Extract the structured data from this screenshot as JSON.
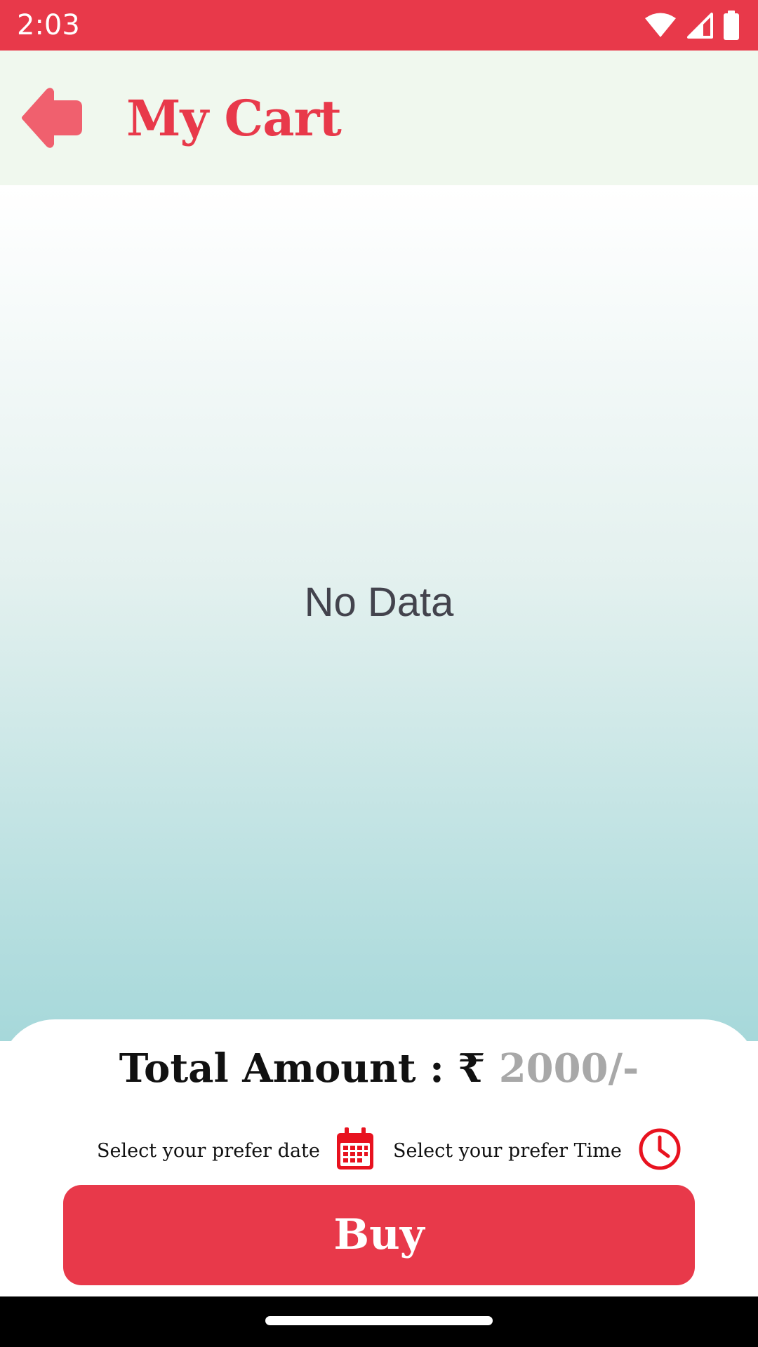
{
  "status_bar": {
    "time": "2:03",
    "icons": [
      "wifi-icon",
      "signal-icon",
      "battery-icon"
    ]
  },
  "header": {
    "back_icon": "back-arrow-icon",
    "title": "My Cart"
  },
  "content": {
    "empty_message": "No Data"
  },
  "summary": {
    "total_label": "Total Amount : ₹",
    "total_value": "2000/-",
    "date_label": "Select your prefer date",
    "date_icon": "calendar-icon",
    "time_label": "Select your prefer Time",
    "time_icon": "clock-icon",
    "buy_label": "Buy"
  },
  "colors": {
    "accent": "#e8394a",
    "back_arrow": "#f0606e",
    "header_background": "#f0f8ee",
    "gradient_bottom": "#a6d8da",
    "total_value": "#a8a8a8"
  }
}
